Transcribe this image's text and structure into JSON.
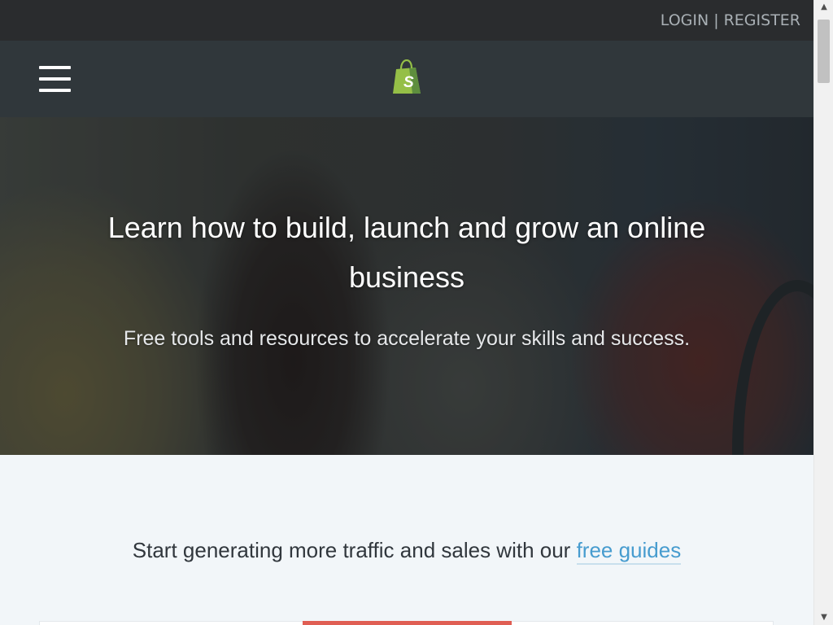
{
  "topbar": {
    "login": "LOGIN",
    "separator": "|",
    "register": "REGISTER"
  },
  "navbar": {
    "menu_icon": "hamburger-menu-icon",
    "logo_icon": "shopify-bag-logo",
    "logo_letter": "S"
  },
  "hero": {
    "title": "Learn how to build, launch and grow an online business",
    "subtitle": "Free tools and resources to accelerate your skills and success."
  },
  "guides": {
    "heading_prefix": "Start generating more traffic and sales with our ",
    "heading_link": "free guides"
  },
  "colors": {
    "topbar_bg": "#2a2c2e",
    "navbar_bg": "#30373b",
    "logo_green": "#95bf47",
    "link_blue": "#479ccf",
    "accent_red": "#e05e53",
    "section_bg": "#f2f6f9"
  },
  "scrollbar": {
    "up_icon": "scroll-up-arrow-icon",
    "down_icon": "scroll-down-arrow-icon"
  }
}
